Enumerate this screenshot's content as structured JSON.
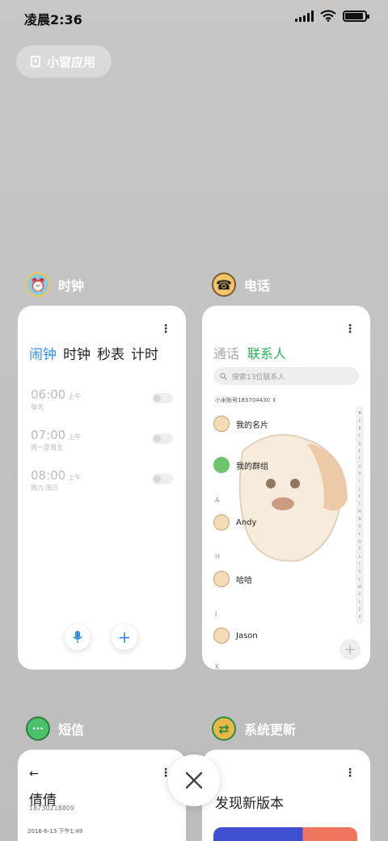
{
  "status": {
    "time": "凌晨2:36",
    "battery_level": 0.9
  },
  "small_window": {
    "label": "小窗应用"
  },
  "apps": {
    "clock": {
      "name": "时钟",
      "tabs": [
        "闹钟",
        "时钟",
        "秒表",
        "计时"
      ],
      "active_tab": "闹钟",
      "alarms": [
        {
          "time": "06:00",
          "ampm": "上午",
          "repeat": "每天"
        },
        {
          "time": "07:00",
          "ampm": "上午",
          "repeat": "周一至周五"
        },
        {
          "time": "08:00",
          "ampm": "上午",
          "repeat": "周六 周日"
        }
      ],
      "mic_icon": "mic-icon",
      "add_icon": "plus-icon"
    },
    "phone": {
      "name": "电话",
      "tabs": [
        "通话",
        "联系人"
      ],
      "active_tab": "联系人",
      "search_placeholder": "搜索13位联系人",
      "account": "小米账号183704430",
      "my_card": "我的名片",
      "my_groups": "我的群组",
      "sections": [
        {
          "letter": "A",
          "contact": "Andy"
        },
        {
          "letter": "H",
          "contact": "哈哈"
        },
        {
          "letter": "J",
          "contact": "Jason"
        }
      ],
      "next_letter": "K",
      "alpha_index": [
        "♥",
        "A",
        "B",
        "C",
        "D",
        "E",
        "F",
        "G",
        "H",
        "I",
        "J",
        "K",
        "L",
        "M",
        "N",
        "O",
        "P",
        "Q",
        "R",
        "S",
        "T",
        "U",
        "V",
        "W",
        "X",
        "Y",
        "Z",
        "#"
      ]
    },
    "sms": {
      "name": "短信",
      "contact_name": "倩倩",
      "contact_number": "18730218809",
      "timestamp": "2016-6-13 下午1:49"
    },
    "update": {
      "name": "系统更新",
      "title": "发现新版本"
    }
  },
  "colors": {
    "clock_accent": "#3a8ee6",
    "phone_accent": "#26b35a",
    "clock_icon_bg": "#8ecbe8",
    "phone_icon_bg": "#f1c56a",
    "sms_icon_bg": "#4cbf6a",
    "update_icon_bg": "#e8b84a"
  }
}
